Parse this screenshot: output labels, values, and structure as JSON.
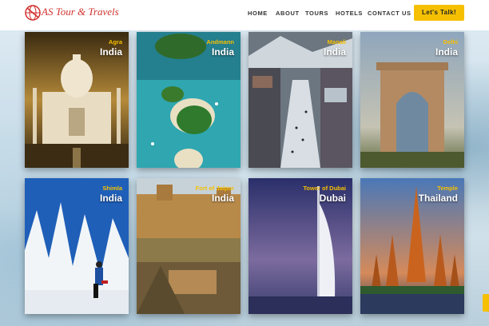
{
  "brand": {
    "name": "AS Tour & Travels",
    "logo_icon": "globe-plane-icon"
  },
  "nav": {
    "items": [
      {
        "label": "HOME"
      },
      {
        "label": "ABOUT"
      },
      {
        "label": "TOURS"
      },
      {
        "label": "HOTELS"
      },
      {
        "label": "CONTACT US"
      }
    ],
    "cta_label": "Let's Talk!"
  },
  "colors": {
    "accent": "#f6c000",
    "brand": "#d0312d"
  },
  "destinations": [
    {
      "place": "Agra",
      "country": "India"
    },
    {
      "place": "Andmann",
      "country": "India"
    },
    {
      "place": "Manali",
      "country": "India"
    },
    {
      "place": "Delhi",
      "country": "India"
    },
    {
      "place": "Shimla",
      "country": "India"
    },
    {
      "place": "Fort of Jaipur",
      "country": "India"
    },
    {
      "place": "Tower of Dubai",
      "country": "Dubai"
    },
    {
      "place": "Temple",
      "country": "Thailand"
    }
  ]
}
